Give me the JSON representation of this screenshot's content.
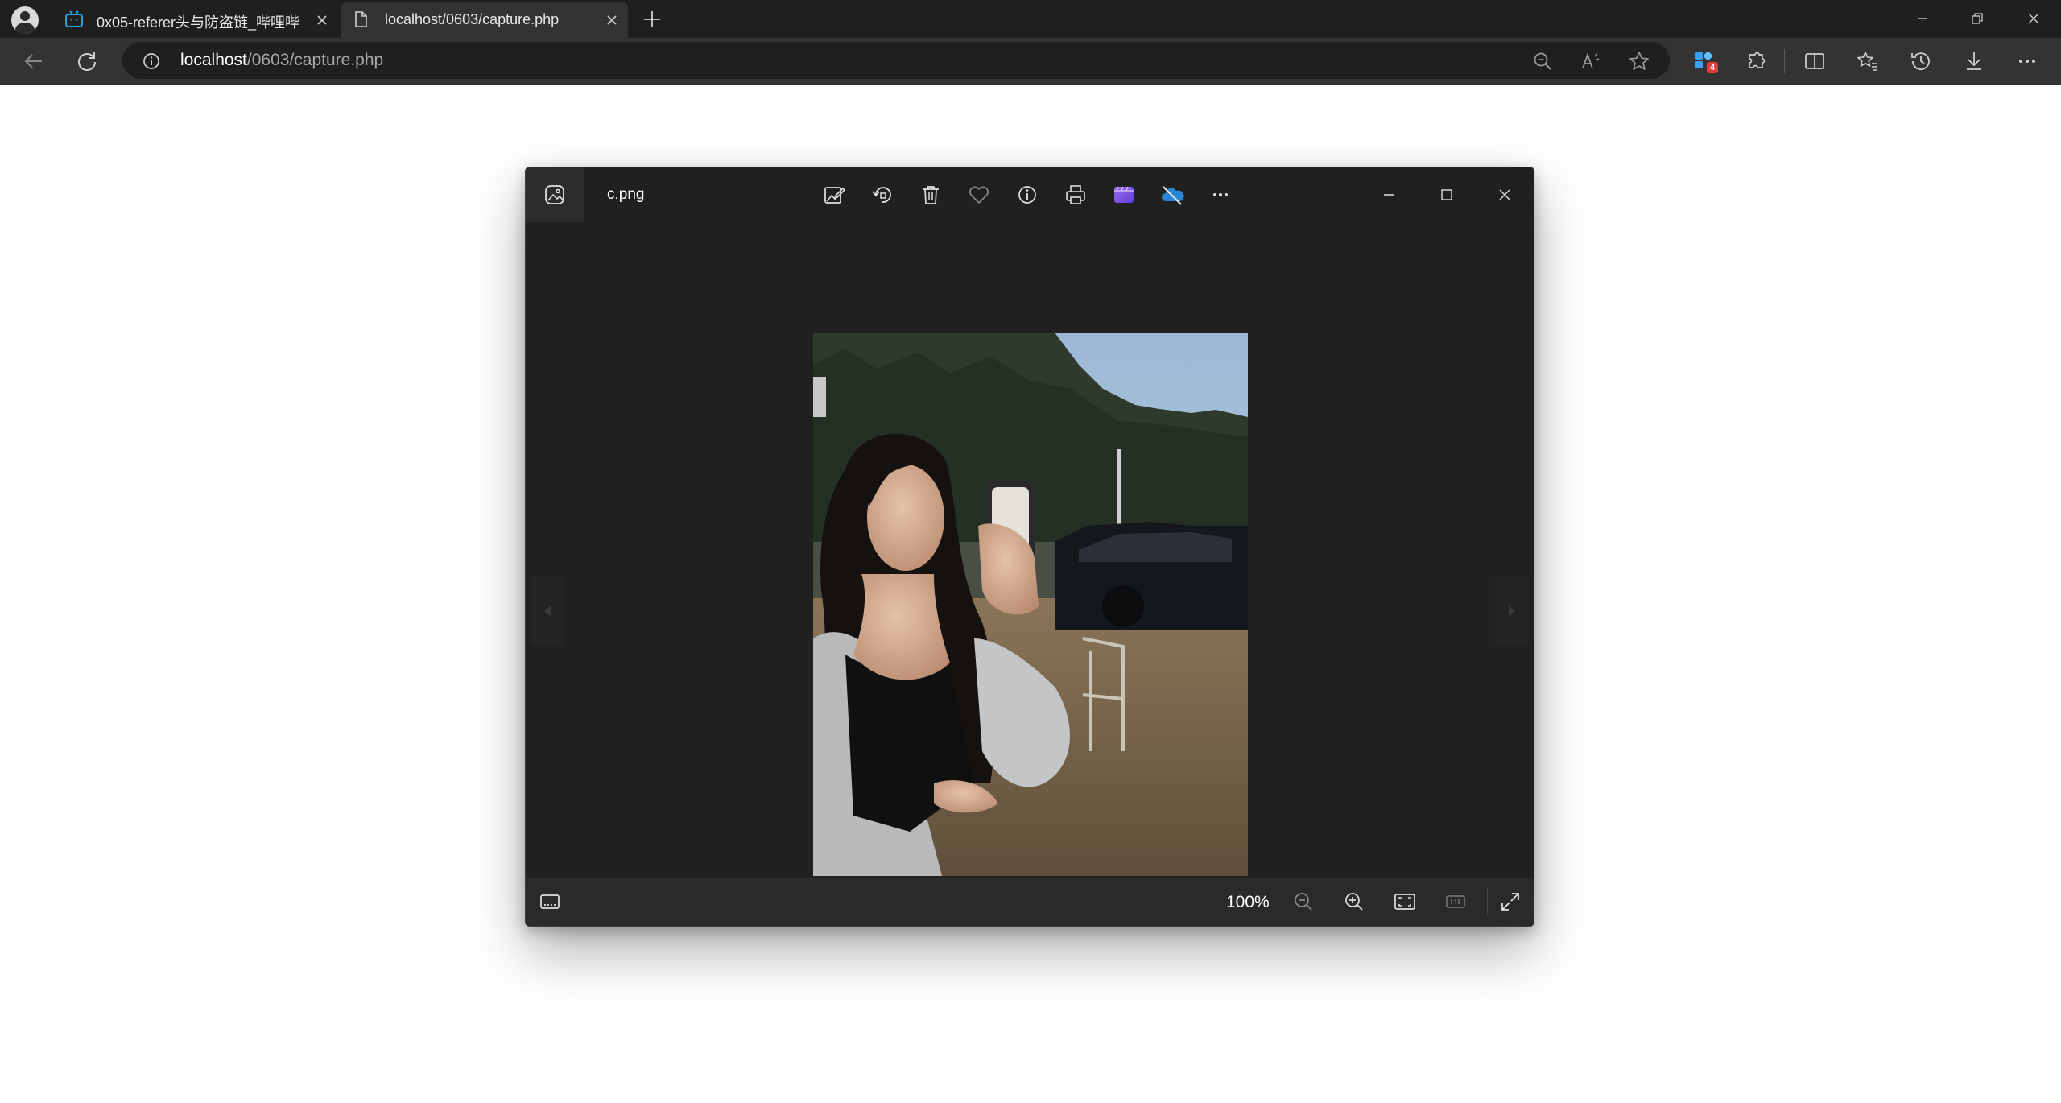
{
  "browser": {
    "tabs": [
      {
        "label": "0x05-referer头与防盗链_哔哩哔哩",
        "favicon": "bilibili-icon",
        "active": false
      },
      {
        "label": "localhost/0603/capture.php",
        "favicon": "page-icon",
        "active": true
      }
    ],
    "address": {
      "host": "localhost",
      "path": "/0603/capture.php"
    },
    "extensions_badge": "4"
  },
  "viewer": {
    "filename": "c.png",
    "toolbar_icons": [
      "edit-image-icon",
      "rotate-icon",
      "delete-icon",
      "favorite-icon",
      "info-icon",
      "print-icon",
      "clipchamp-icon",
      "onedrive-off-icon",
      "more-icon"
    ],
    "window_controls": [
      "minimize-icon",
      "maximize-icon",
      "close-icon"
    ],
    "zoom_level": "100%",
    "bottom_icons": [
      "filmstrip-icon",
      "zoom-out-icon",
      "zoom-in-icon",
      "fit-to-window-icon",
      "actual-size-icon",
      "fullscreen-icon"
    ]
  },
  "colors": {
    "browser_tabbar": "#1f1f1f",
    "browser_toolbar": "#333333",
    "viewer_bg": "#202020",
    "bottom_bar": "#2a2a2a"
  }
}
